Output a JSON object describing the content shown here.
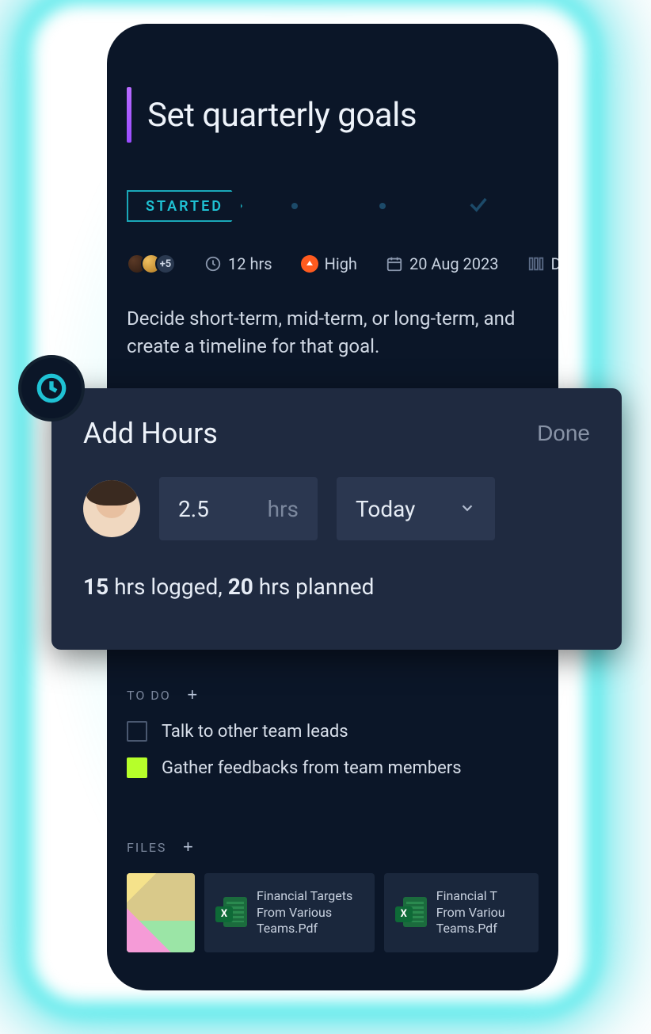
{
  "title": "Set quarterly goals",
  "status": {
    "label": "STARTED"
  },
  "meta": {
    "avatar_more": "+5",
    "hours": "12 hrs",
    "priority": "High",
    "date": "20 Aug 2023",
    "column_truncated": "D"
  },
  "description": "Decide short-term, mid-term, or long-term, and create a timeline for that goal.",
  "panel": {
    "title": "Add Hours",
    "done": "Done",
    "hours_value": "2.5",
    "hours_unit": "hrs",
    "date_value": "Today",
    "summary": {
      "logged_num": "15",
      "logged_text": " hrs logged, ",
      "planned_num": "20",
      "planned_text": " hrs planned"
    }
  },
  "todo": {
    "heading": "TO DO",
    "items": [
      {
        "label": "Talk to other team leads",
        "checked": false
      },
      {
        "label": "Gather feedbacks from team members",
        "checked": true
      }
    ]
  },
  "files": {
    "heading": "FILES",
    "items": [
      {
        "type": "thumb"
      },
      {
        "type": "excel",
        "name": "Financial Targets From Various Teams.Pdf",
        "badge": "X"
      },
      {
        "type": "excel",
        "name_trunc": "Financial T\nFrom Variou\nTeams.Pdf",
        "badge": "X"
      }
    ]
  }
}
